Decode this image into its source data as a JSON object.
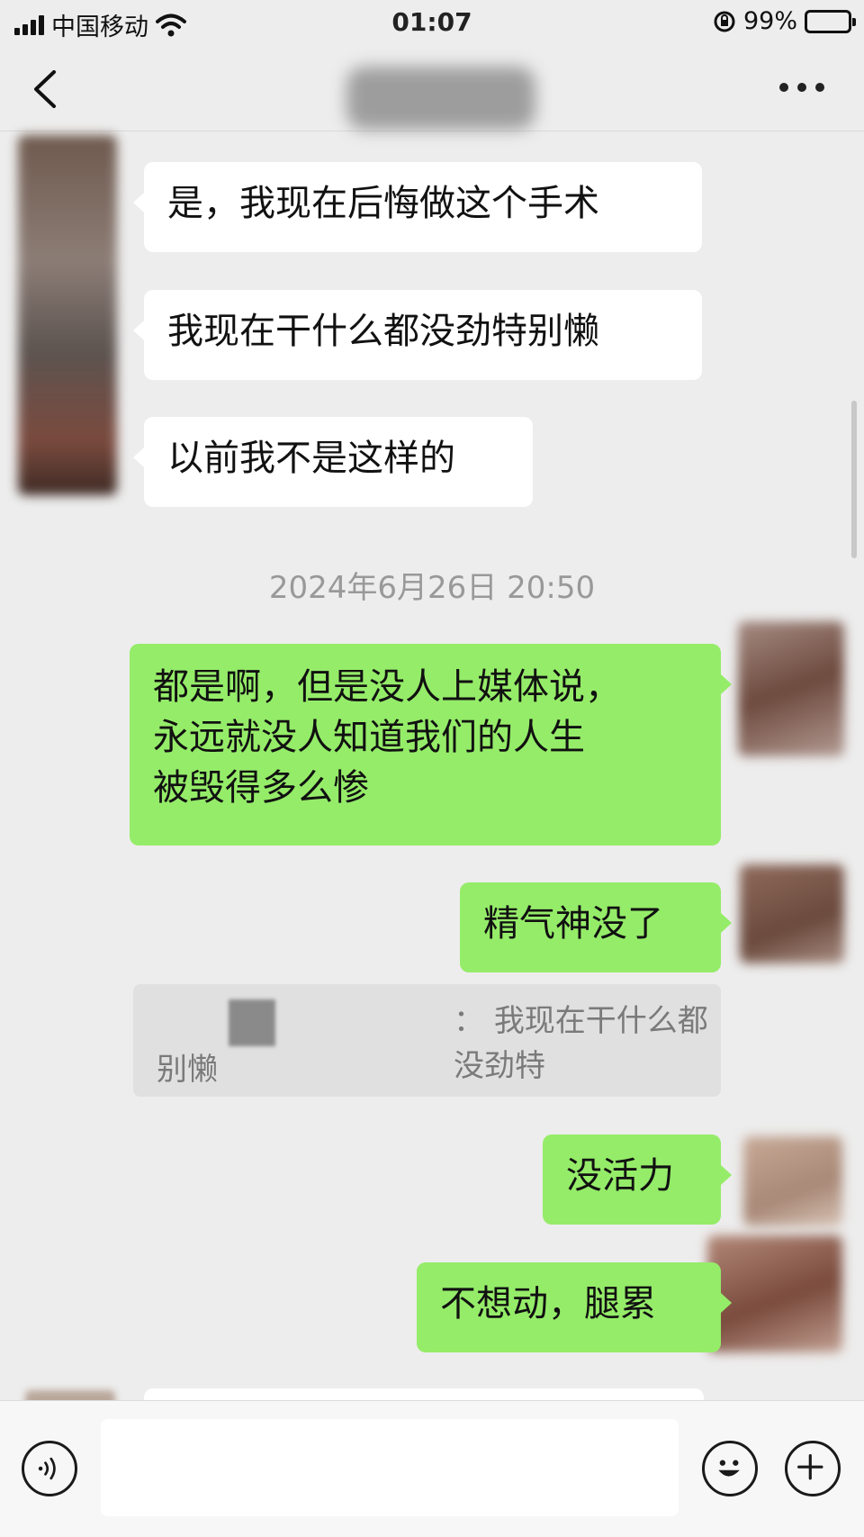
{
  "status_bar": {
    "carrier": "中国移动",
    "time": "01:07",
    "battery": "99%",
    "battery_level": 0.99
  },
  "nav": {
    "back_icon": "chevron-left-icon",
    "more_icon": "more-dots-icon"
  },
  "messages": [
    {
      "side": "in",
      "text": "是，我现在后悔做这个手术"
    },
    {
      "side": "in",
      "text": "我现在干什么都没劲特别懒"
    },
    {
      "side": "in",
      "text": "以前我不是这样的"
    },
    {
      "side": "out",
      "lines": [
        "都是啊，但是没人上媒体说，",
        "永远就没人知道我们的人生",
        "被毁得多么惨"
      ]
    },
    {
      "side": "out",
      "text": "精气神没了"
    },
    {
      "side": "out",
      "text": "没活力"
    },
    {
      "side": "out",
      "text": "不想动，腿累"
    }
  ],
  "timestamp": "2024年6月26日 20:50",
  "quote": {
    "separator": "：",
    "text_line1": "我现在干什么都没劲特",
    "text_line2": "别懒"
  },
  "input_bar": {
    "voice_icon": "voice-icon",
    "emoji_icon": "emoji-icon",
    "plus_icon": "plus-icon"
  },
  "colors": {
    "background": "#ededed",
    "incoming_bubble": "#ffffff",
    "outgoing_bubble": "#95ec69"
  }
}
